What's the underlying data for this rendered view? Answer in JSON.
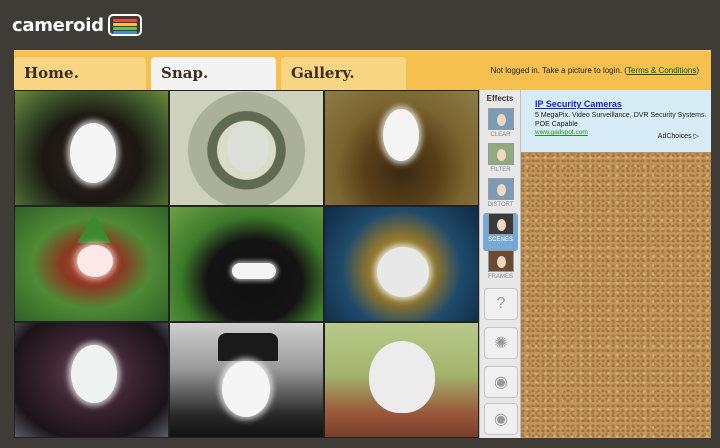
{
  "logo": {
    "text": "cameroid"
  },
  "nav": {
    "tabs": [
      {
        "label": "Home."
      },
      {
        "label": "Snap."
      },
      {
        "label": "Gallery."
      }
    ],
    "active_tab": "Snap.",
    "login_status": "Not logged in. Take a picture to login. (",
    "terms_link": "Terms & Conditions",
    "login_status_end": ")"
  },
  "scenes": [
    {
      "name": "gorilla"
    },
    {
      "name": "dollar-bill"
    },
    {
      "name": "mona-lisa"
    },
    {
      "name": "garden-gnome"
    },
    {
      "name": "ninja"
    },
    {
      "name": "diving-helmet"
    },
    {
      "name": "lightbulb"
    },
    {
      "name": "frankenstein"
    },
    {
      "name": "humpty-dumpty"
    }
  ],
  "effects": {
    "title": "Effects",
    "items": [
      {
        "label": "CLEAR"
      },
      {
        "label": "FILTER"
      },
      {
        "label": "DISTORT"
      },
      {
        "label": "SCENES"
      },
      {
        "label": "FRAMES"
      }
    ],
    "selected": "SCENES",
    "tools": [
      {
        "icon": "help-icon",
        "glyph": "?"
      },
      {
        "icon": "settings-icon",
        "glyph": "✺"
      },
      {
        "icon": "camera-icon",
        "glyph": "◉"
      },
      {
        "icon": "camera-timer-icon",
        "glyph": "◉"
      }
    ]
  },
  "ad": {
    "title": "IP Security Cameras",
    "body": "5 MegaPix. Video Surveillance, DVR Security Systems. POE Capable",
    "url": "www.gadspot.com",
    "adchoices": "AdChoices"
  },
  "colors": {
    "background": "#3f3c37",
    "navbar": "#f5c04f",
    "tab": "#f7d582",
    "tab_active": "#f3f3f3",
    "selected_effect": "#76a9d6",
    "ad_background": "#d7ecf6",
    "ad_link": "#1a21c7"
  }
}
